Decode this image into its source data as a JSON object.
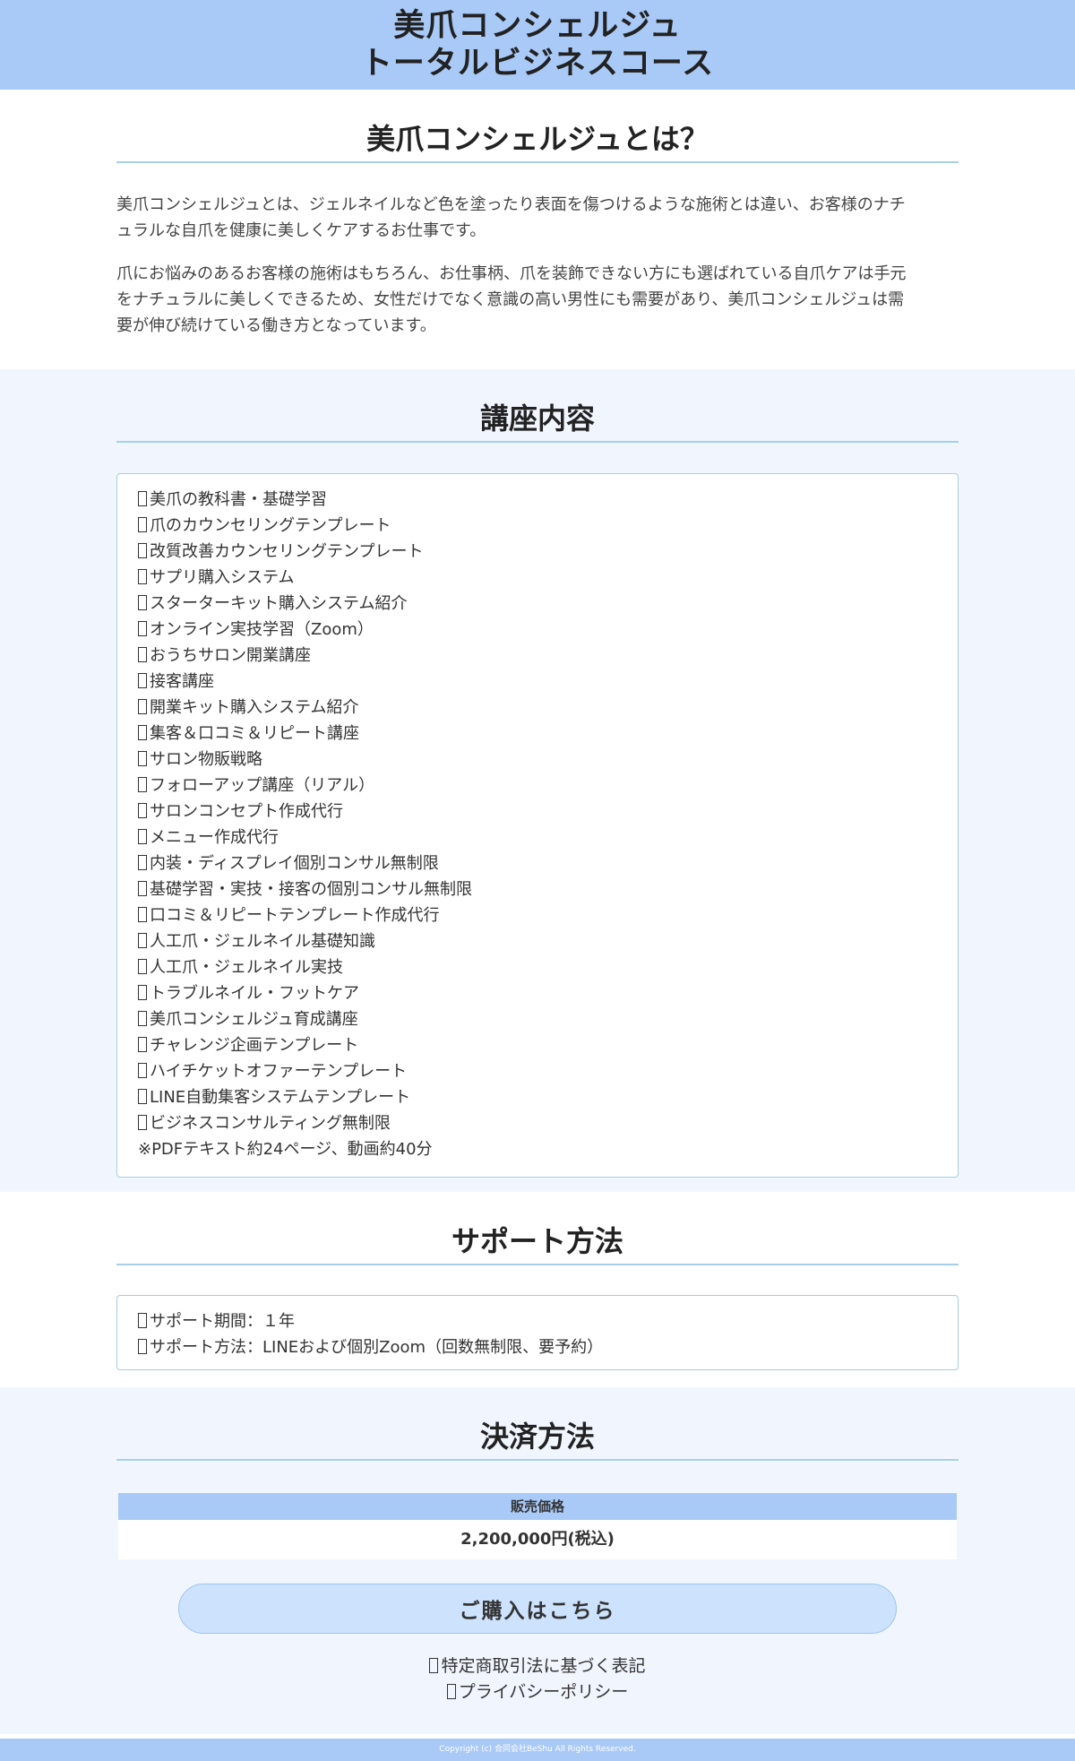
{
  "header": {
    "title_line1": "美爪コンシェルジュ",
    "title_line2": "トータルビジネスコース"
  },
  "about": {
    "title": "美爪コンシェルジュとは？",
    "p1_line1": "美爪コンシェルジュとは、ジェルネイルなど色を塗ったり表面を傷つけるような施術とは違い、お客様のナチ",
    "p1_line2": "ュラルな自爪を健康に美しくケアするお仕事です。",
    "p2_line1": "爪にお悩みのあるお客様の施術はもちろん、お仕事柄、爪を装飾できない方にも選ばれている自爪ケアは手元",
    "p2_line2": "をナチュラルに美しくできるため、女性だけでなく意識の高い男性にも需要があり、美爪コンシェルジュは需",
    "p2_line3": "要が伸び続けている働き方となっています。"
  },
  "course": {
    "title": "講座内容",
    "items": [
      "美爪の教科書・基礎学習",
      "爪のカウンセリングテンプレート",
      "改質改善カウンセリングテンプレート",
      "サプリ購入システム",
      "スターターキット購入システム紹介",
      "オンライン実技学習（Zoom）",
      "おうちサロン開業講座",
      "接客講座",
      "開業キット購入システム紹介",
      "集客＆口コミ＆リピート講座",
      "サロン物販戦略",
      "フォローアップ講座（リアル）",
      "サロンコンセプト作成代行",
      "メニュー作成代行",
      "内装・ディスプレイ個別コンサル無制限",
      "基礎学習・実技・接客の個別コンサル無制限",
      "口コミ＆リピートテンプレート作成代行",
      "人工爪・ジェルネイル基礎知識",
      "人工爪・ジェルネイル実技",
      "トラブルネイル・フットケア",
      "美爪コンシェルジュ育成講座",
      "チャレンジ企画テンプレート",
      "ハイチケットオファーテンプレート",
      "LINE自動集客システムテンプレート",
      "ビジネスコンサルティング無制限"
    ],
    "note": "※PDFテキスト約24ページ、動画約40分"
  },
  "support": {
    "title": "サポート方法",
    "items": [
      "サポート期間：１年",
      "サポート方法：LINEおよび個別Zoom（回数無制限、要予約）"
    ]
  },
  "payment": {
    "title": "決済方法",
    "price_label": "販売価格",
    "price_value": "2,200,000円(税込)",
    "buy_button": "ご購入はこちら",
    "link_legal": "特定商取引法に基づく表記",
    "link_privacy": "プライバシーポリシー"
  },
  "footer": {
    "copyright": "Copyright (c) 合同会社BeShu All Rights Reserved."
  }
}
